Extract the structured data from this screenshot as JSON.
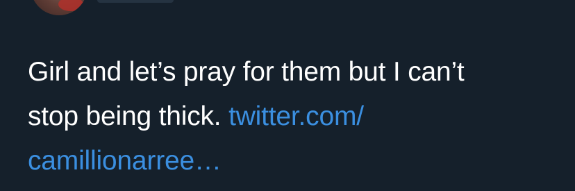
{
  "tweet": {
    "text_line1": "Girl and let’s pray for them but I can’t",
    "text_line2": "stop being thick. ",
    "link_part1": "twitter.com/",
    "link_part2": "camillionarree…"
  }
}
